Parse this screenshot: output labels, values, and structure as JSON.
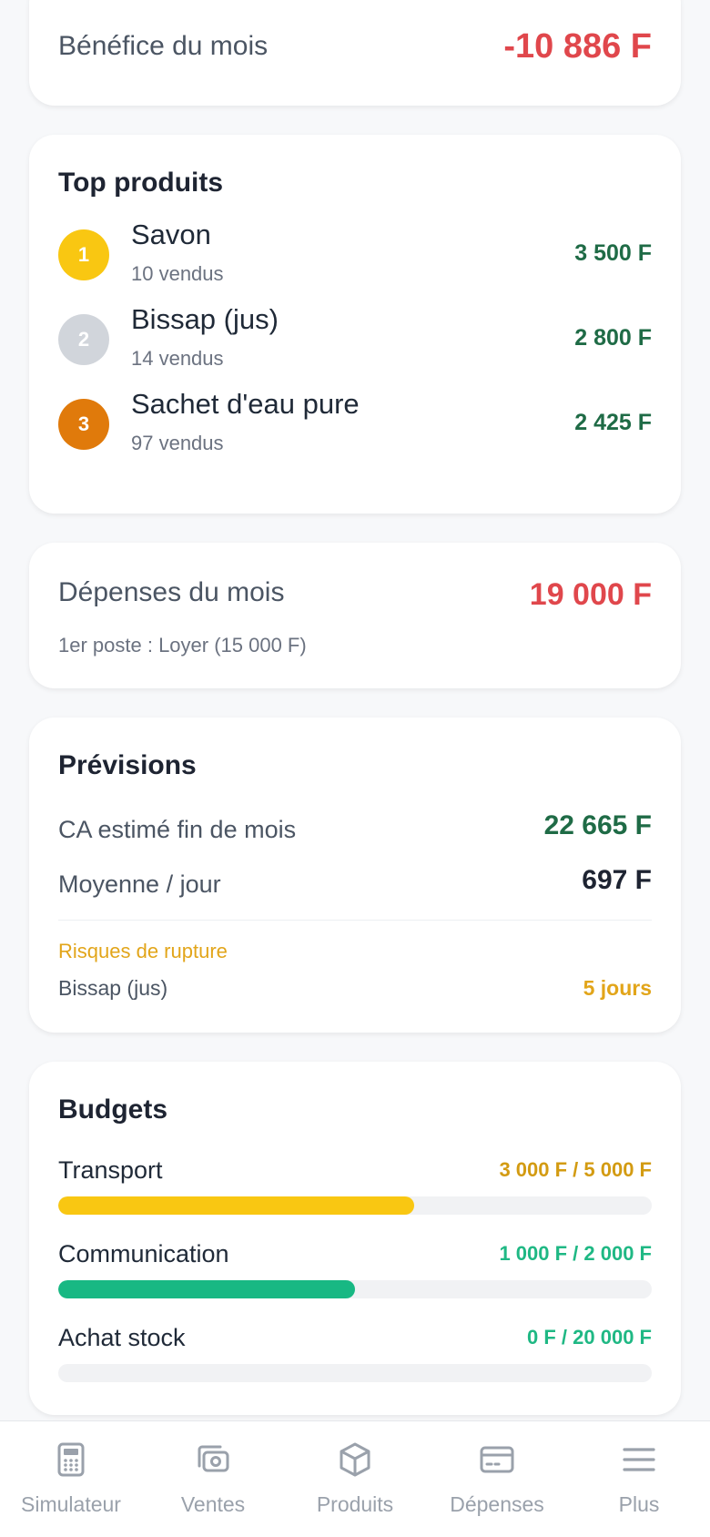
{
  "benefice": {
    "label": "Bénéfice du mois",
    "value": "-10 886 F"
  },
  "top_produits": {
    "title": "Top produits",
    "items": [
      {
        "rank": "1",
        "name": "Savon",
        "sold": "10 vendus",
        "amount": "3 500 F",
        "rank_color": "#f9c712"
      },
      {
        "rank": "2",
        "name": "Bissap (jus)",
        "sold": "14 vendus",
        "amount": "2 800 F",
        "rank_color": "#d1d5db"
      },
      {
        "rank": "3",
        "name": "Sachet d'eau pure",
        "sold": "97 vendus",
        "amount": "2 425 F",
        "rank_color": "#e07a0b"
      }
    ]
  },
  "depenses": {
    "label": "Dépenses du mois",
    "value": "19 000 F",
    "sub": "1er poste : Loyer (15 000 F)"
  },
  "previsions": {
    "title": "Prévisions",
    "ca_label": "CA estimé fin de mois",
    "ca_value": "22 665 F",
    "moy_label": "Moyenne / jour",
    "moy_value": "697 F",
    "risk_title": "Risques de rupture",
    "risk_item": "Bissap (jus)",
    "risk_value": "5 jours"
  },
  "budgets": {
    "title": "Budgets",
    "items": [
      {
        "label": "Transport",
        "value": "3 000 F / 5 000 F",
        "progress": 0.6,
        "color": "#d39b12",
        "bar_color": "#f9c712"
      },
      {
        "label": "Communication",
        "value": "1 000 F / 2 000 F",
        "progress": 0.5,
        "color": "#1fb884",
        "bar_color": "#18b883"
      },
      {
        "label": "Achat stock",
        "value": "0 F / 20 000 F",
        "progress": 0.0,
        "color": "#1fb884",
        "bar_color": "#18b883"
      }
    ]
  },
  "nav": {
    "items": [
      {
        "label": "Simulateur",
        "icon": "calculator-icon"
      },
      {
        "label": "Ventes",
        "icon": "cash-icon"
      },
      {
        "label": "Produits",
        "icon": "box-icon"
      },
      {
        "label": "Dépenses",
        "icon": "card-icon"
      },
      {
        "label": "Plus",
        "icon": "menu-icon"
      }
    ]
  }
}
